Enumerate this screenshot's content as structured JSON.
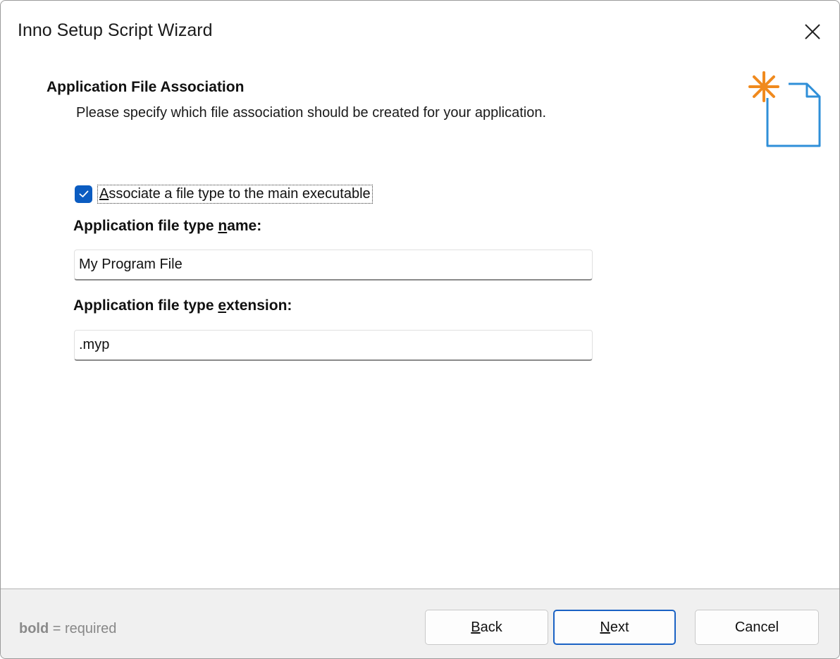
{
  "window": {
    "title": "Inno Setup Script Wizard",
    "close_icon": "close-icon"
  },
  "header": {
    "title": "Application File Association",
    "subtitle": "Please specify which file association should be created for your application.",
    "icon": "new-document-sparkle-icon"
  },
  "form": {
    "associate": {
      "checked": true,
      "label_mnemonic": "A",
      "label_rest": "ssociate a file type to the main executable"
    },
    "type_name": {
      "label_before": "Application file type ",
      "label_mnemonic": "n",
      "label_after": "ame:",
      "value": "My Program File"
    },
    "type_extension": {
      "label_before": "Application file type ",
      "label_mnemonic": "e",
      "label_after": "xtension:",
      "value": ".myp"
    }
  },
  "footer": {
    "note_bold": "bold",
    "note_rest": " = required",
    "buttons": {
      "back_mnemonic": "B",
      "back_rest": "ack",
      "next_mnemonic": "N",
      "next_rest": "ext",
      "cancel": "Cancel"
    }
  },
  "colors": {
    "accent": "#0b5cc1",
    "footer_bg": "#f0f0f0",
    "icon_orange": "#f08a1e",
    "icon_blue": "#2f8fd8"
  }
}
